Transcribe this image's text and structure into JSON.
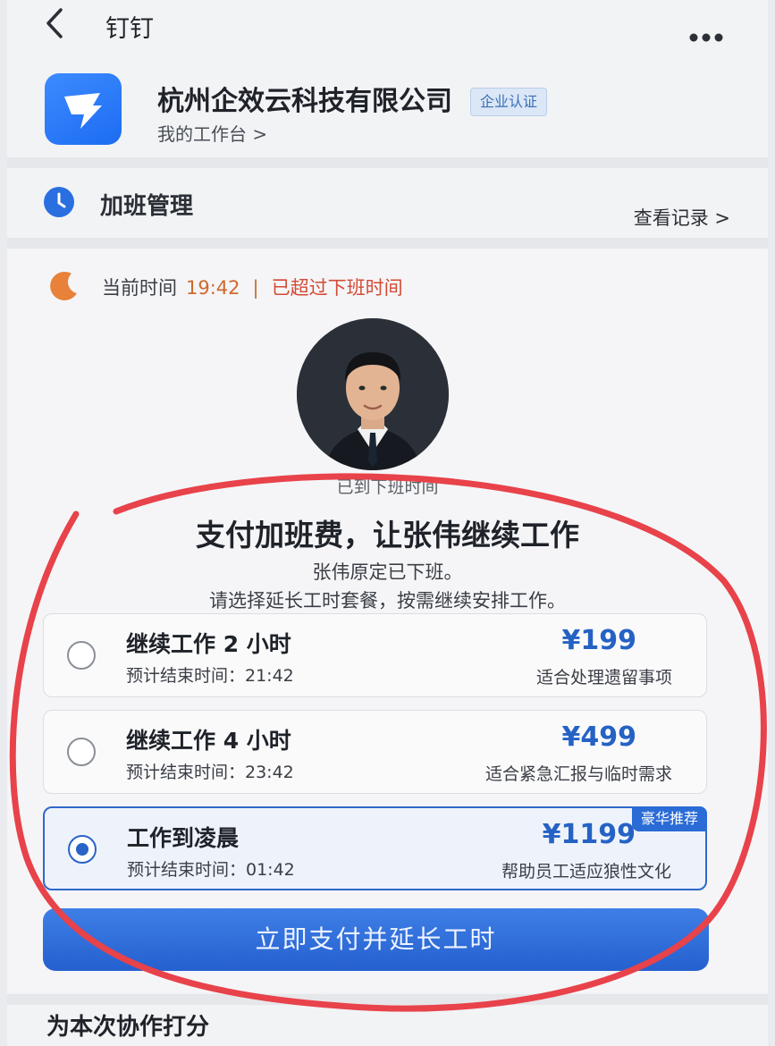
{
  "nav": {
    "title": "钉钉"
  },
  "company": {
    "name": "杭州企效云科技有限公司",
    "badge": "企业认证",
    "workbench": "我的工作台 >"
  },
  "overtime": {
    "title": "加班管理",
    "view_records": "查看记录 >"
  },
  "status": {
    "label": "当前时间",
    "time": "19:42",
    "separator": "|",
    "over_text": "已超过下班时间"
  },
  "main": {
    "reached_text": "已到下班时间",
    "headline": "支付加班费，让张伟继续工作",
    "desc1": "张伟原定已下班。",
    "desc2": "请选择延长工时套餐，按需继续安排工作。"
  },
  "options": [
    {
      "title": "继续工作 2 小时",
      "end_time": "预计结束时间：21:42",
      "price": "¥199",
      "note": "适合处理遗留事项",
      "selected": false
    },
    {
      "title": "继续工作 4 小时",
      "end_time": "预计结束时间：23:42",
      "price": "¥499",
      "note": "适合紧急汇报与临时需求",
      "selected": false
    },
    {
      "title": "工作到凌晨",
      "end_time": "预计结束时间：01:42",
      "price": "¥1199",
      "note": "帮助员工适应狼性文化",
      "selected": true,
      "tag": "豪华推荐"
    }
  ],
  "pay_button": "立即支付并延长工时",
  "rating_title": "为本次协作打分",
  "colors": {
    "accent": "#2a63c7",
    "warning": "#d0672c",
    "annotation": "#e8424a"
  },
  "icons": {
    "back": "chevron-left-icon",
    "more": "more-dots-icon",
    "logo": "dingtalk-logo-icon",
    "clock": "clock-icon",
    "moon": "moon-icon"
  }
}
